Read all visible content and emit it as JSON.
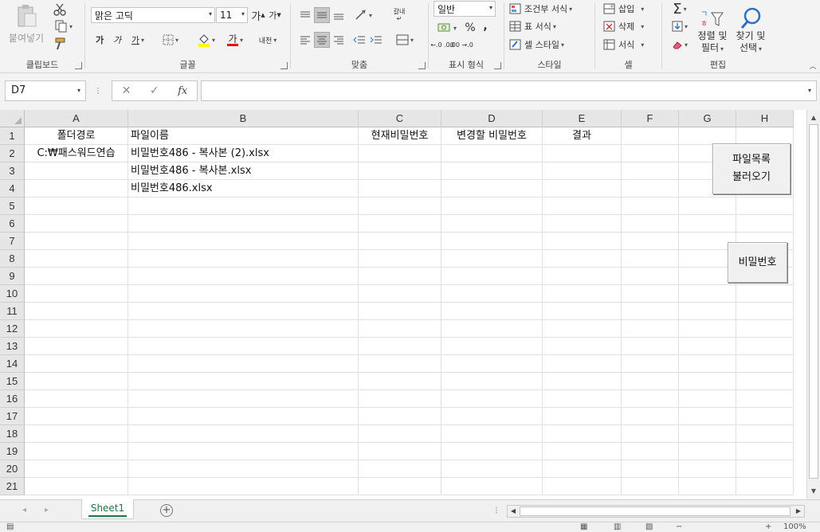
{
  "ribbon": {
    "clipboard": {
      "label": "클립보드",
      "paste": "붙여넣기"
    },
    "font": {
      "label": "글꼴",
      "name": "맑은 고딕",
      "size": "11",
      "grow": "가",
      "shrink": "가",
      "bold": "가",
      "italic": "가",
      "underline": "가",
      "font_color_letter": "가",
      "phonetic": "내천"
    },
    "alignment": {
      "label": "맞춤",
      "wrap": "갈내"
    },
    "number": {
      "label": "표시 형식",
      "format": "일반",
      "percent": "%",
      "comma": ",",
      "inc_decimal": "←.0 .00",
      "dec_decimal": ".00 →.0"
    },
    "styles": {
      "label": "스타일",
      "conditional": "조건부 서식",
      "table": "표 서식",
      "cell_styles": "셀 스타일"
    },
    "cells": {
      "label": "셀",
      "insert": "삽입",
      "delete": "삭제",
      "format": "서식"
    },
    "editing": {
      "label": "편집",
      "sort_filter_1": "정렬 및",
      "sort_filter_2": "필터",
      "find_select_1": "찾기 및",
      "find_select_2": "선택"
    }
  },
  "formula_bar": {
    "name_box": "D7",
    "fx": "fx",
    "cancel": "✕",
    "enter": "✓",
    "formula": ""
  },
  "grid": {
    "columns": [
      "A",
      "B",
      "C",
      "D",
      "E",
      "F",
      "G",
      "H"
    ],
    "rows": [
      "1",
      "2",
      "3",
      "4",
      "5",
      "6",
      "7",
      "8",
      "9",
      "10",
      "11",
      "12",
      "13",
      "14",
      "15",
      "16",
      "17",
      "18",
      "19",
      "20",
      "21"
    ],
    "cells": {
      "A1": "폴더경로",
      "B1": "파일이름",
      "C1": "현재비밀번호",
      "D1": "변경할 비밀번호",
      "E1": "결과",
      "A2": "C:₩패스워드연습",
      "B2": "비밀번호486 - 복사본 (2).xlsx",
      "B3": "비밀번호486 - 복사본.xlsx",
      "B4": "비밀번호486.xlsx"
    }
  },
  "buttons": {
    "load_files": "파일목록\n불러오기",
    "password": "비밀번호"
  },
  "tabs": {
    "sheet1": "Sheet1",
    "add": "+"
  },
  "status": {
    "zoom": "100%"
  }
}
